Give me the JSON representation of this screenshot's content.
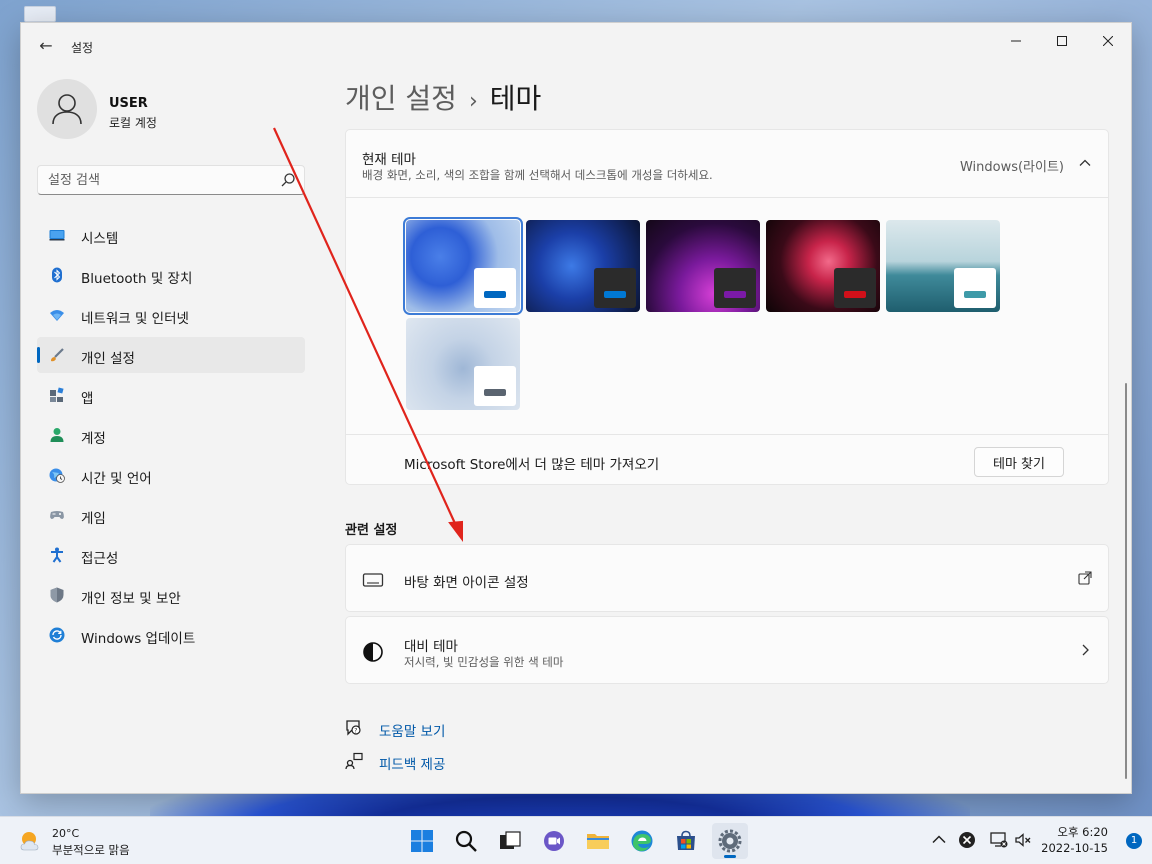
{
  "window": {
    "app_title": "설정"
  },
  "profile": {
    "name": "USER",
    "account_type": "로컬 계정"
  },
  "search": {
    "placeholder": "설정 검색"
  },
  "sidebar": {
    "items": [
      {
        "label": "시스템",
        "icon": "monitor-icon"
      },
      {
        "label": "Bluetooth 및 장치",
        "icon": "bluetooth-icon"
      },
      {
        "label": "네트워크 및 인터넷",
        "icon": "wifi-icon"
      },
      {
        "label": "개인 설정",
        "icon": "brush-icon",
        "active": true
      },
      {
        "label": "앱",
        "icon": "apps-icon"
      },
      {
        "label": "계정",
        "icon": "person-icon"
      },
      {
        "label": "시간 및 언어",
        "icon": "globe-clock-icon"
      },
      {
        "label": "게임",
        "icon": "gamepad-icon"
      },
      {
        "label": "접근성",
        "icon": "accessibility-icon"
      },
      {
        "label": "개인 정보 및 보안",
        "icon": "shield-icon"
      },
      {
        "label": "Windows 업데이트",
        "icon": "update-icon"
      }
    ]
  },
  "breadcrumb": {
    "parent": "개인 설정",
    "separator": "›",
    "current": "테마"
  },
  "theme_card": {
    "title": "현재 테마",
    "description": "배경 화면, 소리, 색의 조합을 함께 선택해서 데스크톱에 개성을 더하세요.",
    "current_value": "Windows(라이트)",
    "themes": [
      {
        "name": "windows-light",
        "panel": "#ffffff",
        "bar": "#0067c0",
        "selected": true
      },
      {
        "name": "windows-dark",
        "panel": "#2b2b2b",
        "bar": "#0078d4"
      },
      {
        "name": "glow",
        "panel": "#2b2b2b",
        "bar": "#7a1aa8"
      },
      {
        "name": "captured-motion",
        "panel": "#2b2b2b",
        "bar": "#d0101a"
      },
      {
        "name": "sunrise",
        "panel": "#ffffff",
        "bar": "#3e9aa8"
      },
      {
        "name": "flow",
        "panel": "#ffffff",
        "bar": "#5a6470"
      }
    ],
    "store_text": "Microsoft Store에서 더 많은 테마 가져오기",
    "find_button": "테마 찾기"
  },
  "related": {
    "title": "관련 설정",
    "desktop_icons": "바탕 화면 아이콘 설정",
    "contrast_title": "대비 테마",
    "contrast_sub": "저시력, 빛 민감성을 위한 색 테마"
  },
  "help": {
    "get_help": "도움말 보기",
    "feedback": "피드백 제공"
  },
  "taskbar": {
    "weather_temp": "20°C",
    "weather_cond": "부분적으로 맑음",
    "time": "오후 6:20",
    "date": "2022-10-15",
    "notifications": "1"
  },
  "colors": {
    "accent": "#0067c0",
    "annotation_arrow": "#e0241c"
  }
}
